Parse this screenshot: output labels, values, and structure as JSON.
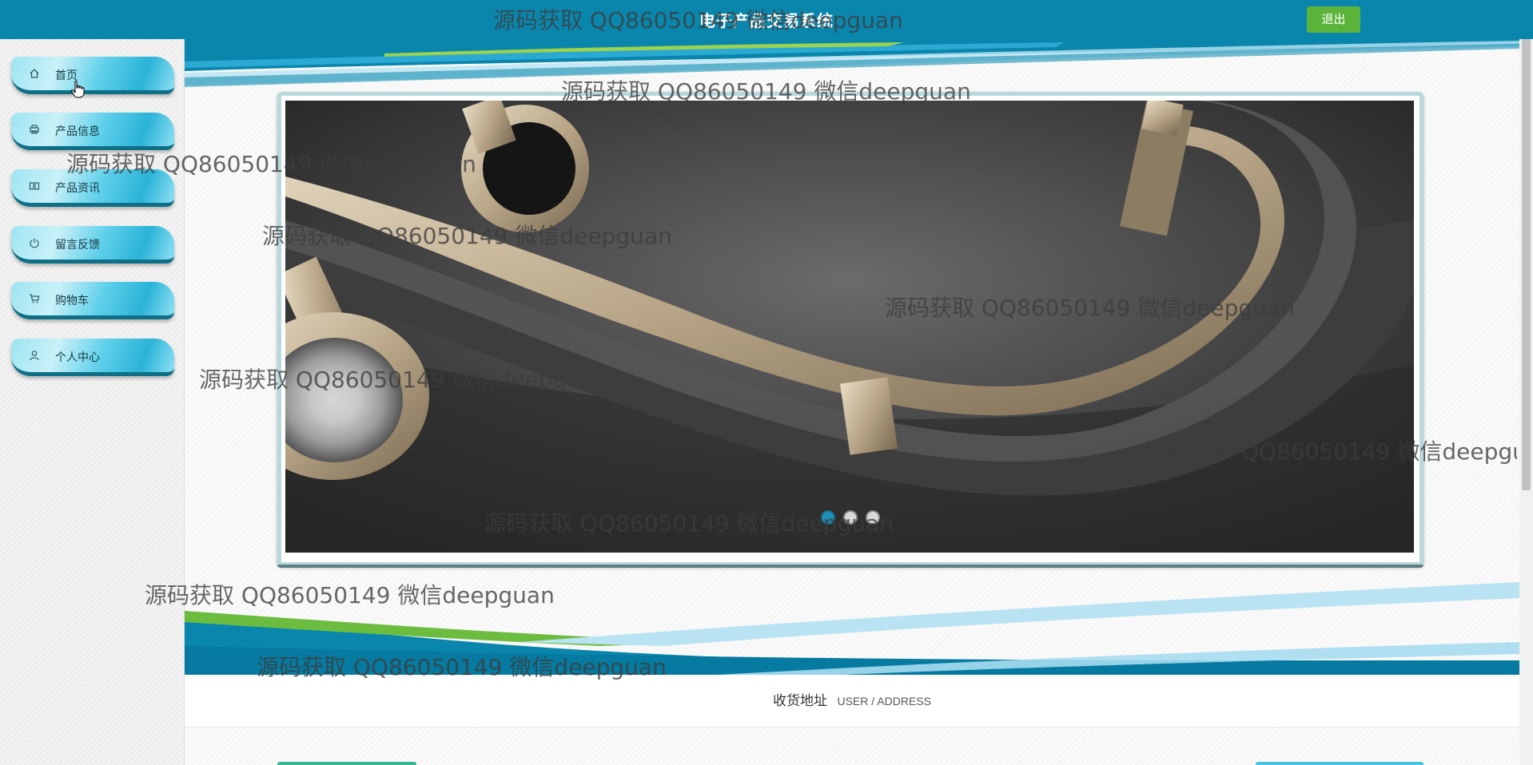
{
  "header": {
    "title": "电子产品交易系统",
    "logout_label": "退出",
    "bg_color": "#0a86ad",
    "logout_color": "#5bb339"
  },
  "sidebar": {
    "items": [
      {
        "label": "首页",
        "icon": "home-icon"
      },
      {
        "label": "产品信息",
        "icon": "printer-icon"
      },
      {
        "label": "产品资讯",
        "icon": "book-icon"
      },
      {
        "label": "留言反馈",
        "icon": "power-icon"
      },
      {
        "label": "购物车",
        "icon": "cart-icon"
      },
      {
        "label": "个人中心",
        "icon": "user-icon"
      }
    ]
  },
  "carousel": {
    "active_index": 0,
    "dot_count": 3
  },
  "address": {
    "label_cn": "收货地址",
    "label_en": "USER / ADDRESS"
  },
  "watermark": {
    "text": "源码获取 QQ86050149 微信deepguan"
  }
}
